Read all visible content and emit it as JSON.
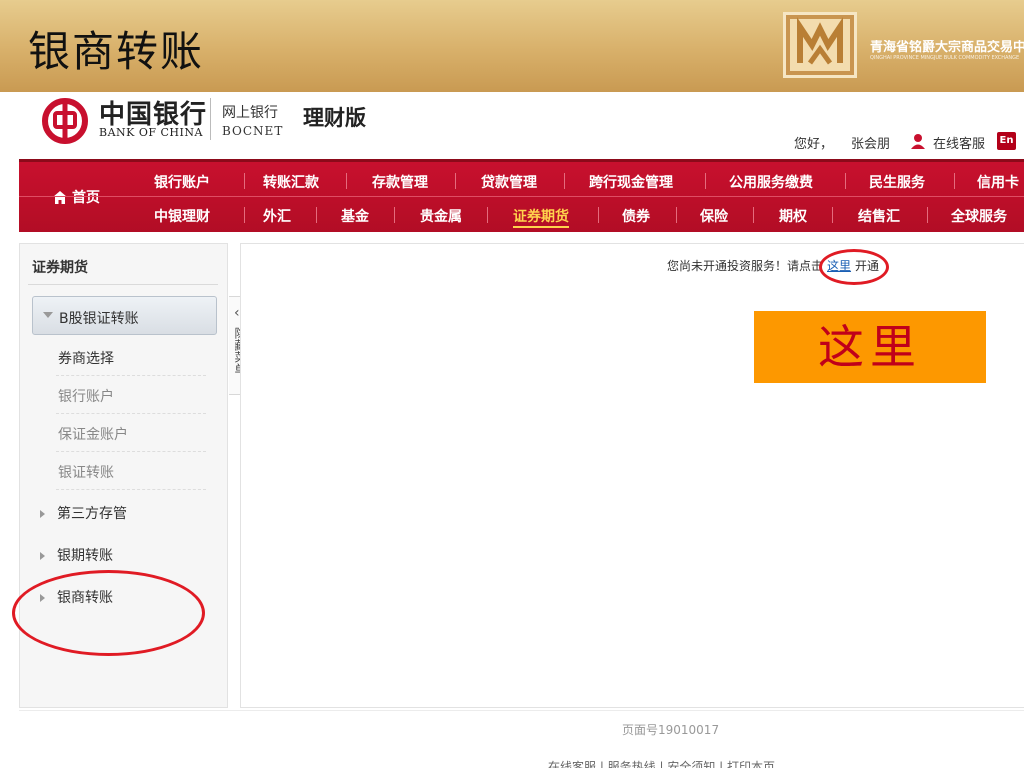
{
  "slide": {
    "title": "银商转账",
    "corp_name_cn": "青海省铭爵大宗商品交易中心",
    "corp_name_en": "QINGHAI PROVINCE MINGJUE BULK COMMODITY EXCHANGE"
  },
  "bank": {
    "name_cn": "中国银行",
    "name_en": "BANK OF CHINA",
    "net_cn": "网上银行",
    "net_en": "BOCNET",
    "edition": "理财版",
    "greeting": "您好，",
    "user": "张会朋",
    "service": "在线客服",
    "lang": "En"
  },
  "nav": {
    "home": "首页",
    "row1": [
      "银行账户",
      "转账汇款",
      "存款管理",
      "贷款管理",
      "跨行现金管理",
      "公用服务缴费",
      "民生服务",
      "信用卡"
    ],
    "row2": [
      "中银理财",
      "外汇",
      "基金",
      "贵金属",
      "证券期货",
      "债券",
      "保险",
      "期权",
      "结售汇",
      "全球服务"
    ],
    "active": "证券期货"
  },
  "sidebar": {
    "title": "证券期货",
    "active_group": "B股银证转账",
    "sub_items": [
      "券商选择",
      "银行账户",
      "保证金账户",
      "银证转账"
    ],
    "groups": [
      "第三方存管",
      "银期转账",
      "银商转账"
    ],
    "collapse_label": "隐藏菜单"
  },
  "main": {
    "notice_pre": "您尚未开通投资服务！请点击",
    "notice_link": "这里",
    "notice_post": "开通"
  },
  "callout": "这里",
  "footer": {
    "page_no": "页面号19010017",
    "links": "在线客服 | 服务热线 | 安全须知 | 打印本页"
  },
  "colors": {
    "nav_red": "#c8102e",
    "active_nav": "#ffd34d",
    "annotation_red": "#e01b24",
    "callout_bg": "#fd9800",
    "link_blue": "#1a5fb4"
  }
}
